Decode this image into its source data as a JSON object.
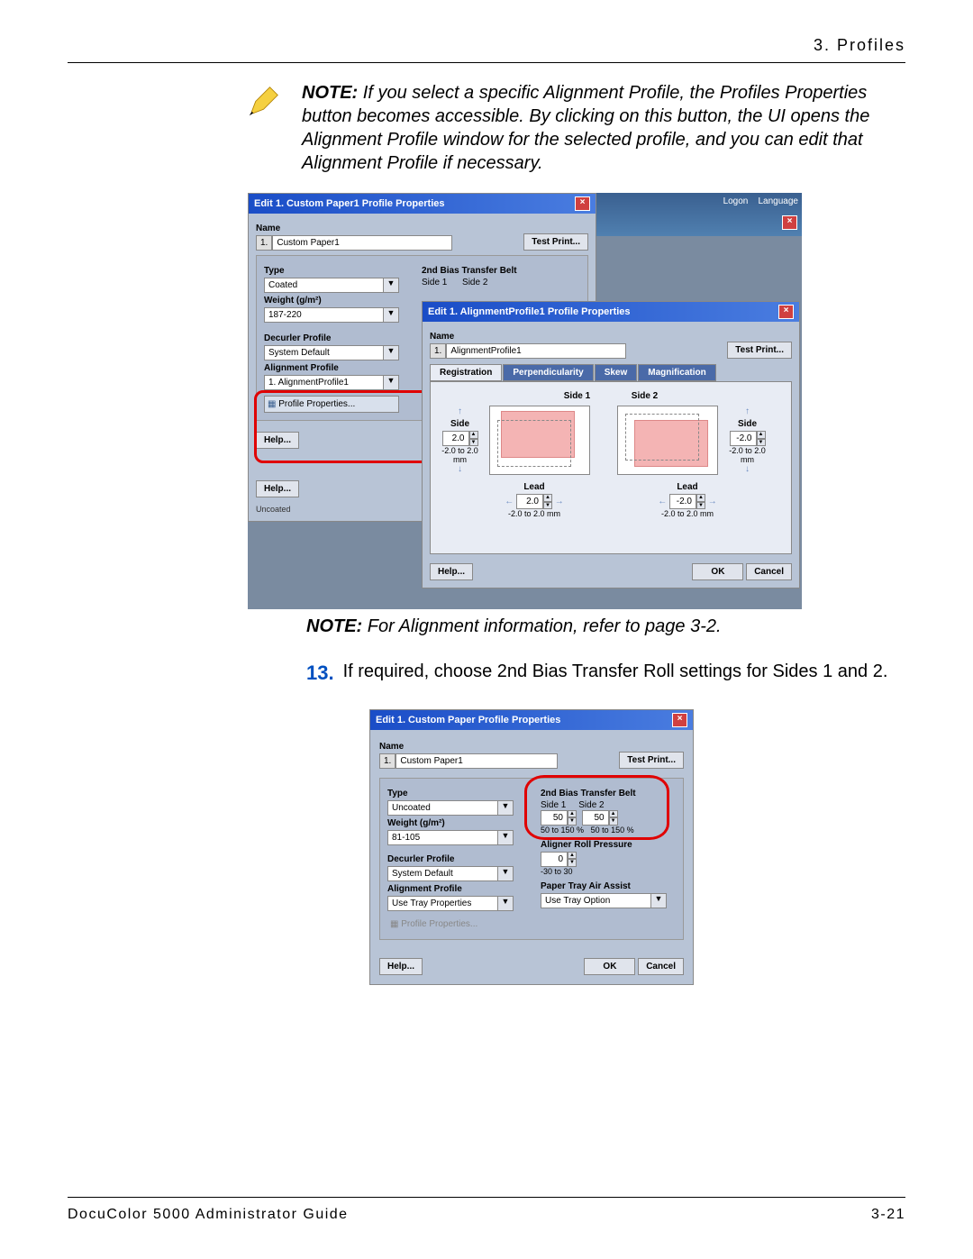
{
  "header": {
    "chapter": "3. Profiles"
  },
  "note1": {
    "prefix": "NOTE:",
    "body": " If you select a specific Alignment Profile, the Profiles Properties button becomes accessible. By clicking on this button, the UI opens the Alignment Profile window for the selected profile, and you can edit that Alignment Profile if necessary."
  },
  "win1": {
    "title": "Edit 1. Custom Paper1 Profile Properties",
    "name_label": "Name",
    "name_num": "1.",
    "name_value": "Custom Paper1",
    "test_print": "Test Print...",
    "type_label": "Type",
    "type_value": "Coated",
    "bias_label": "2nd Bias Transfer Belt",
    "side1": "Side 1",
    "side2": "Side 2",
    "weight_label": "Weight (g/m²)",
    "weight_value": "187-220",
    "decurler_label": "Decurler Profile",
    "decurler_value": "System Default",
    "alignment_label": "Alignment Profile",
    "alignment_value": "1. AlignmentProfile1",
    "profile_props": "Profile Properties...",
    "help": "Help...",
    "uncoated": "Uncoated"
  },
  "topbar": {
    "logon": "Logon",
    "lang": "Language"
  },
  "win2": {
    "title": "Edit 1. AlignmentProfile1 Profile Properties",
    "name_label": "Name",
    "name_num": "1.",
    "name_value": "AlignmentProfile1",
    "test_print": "Test Print...",
    "tabs": {
      "reg": "Registration",
      "perp": "Perpendicularity",
      "skew": "Skew",
      "mag": "Magnification"
    },
    "side1": "Side 1",
    "side2": "Side 2",
    "side": "Side",
    "lead": "Lead",
    "side_val1": "2.0",
    "side_val2": "-2.0",
    "lead_val1": "2.0",
    "lead_val2": "-2.0",
    "range": "-2.0 to 2.0 mm",
    "help": "Help...",
    "ok": "OK",
    "cancel": "Cancel"
  },
  "note2": {
    "prefix": "NOTE:",
    "body": " For Alignment information, refer to page 3-2."
  },
  "step13": {
    "num": "13.",
    "body": "If required, choose 2nd Bias Transfer Roll settings for Sides 1 and 2."
  },
  "s2": {
    "title": "Edit 1. Custom Paper Profile Properties",
    "name_label": "Name",
    "name_num": "1.",
    "name_value": "Custom Paper1",
    "test_print": "Test Print...",
    "type_label": "Type",
    "type_value": "Uncoated",
    "bias_label": "2nd Bias Transfer Belt",
    "side1": "Side 1",
    "side2": "Side 2",
    "bias_val": "50",
    "bias_range": "50 to 150 %",
    "weight_label": "Weight (g/m²)",
    "weight_value": "81-105",
    "aligner_label": "Aligner Roll Pressure",
    "aligner_val": "0",
    "aligner_range": "-30 to 30",
    "decurler_label": "Decurler Profile",
    "decurler_value": "System Default",
    "air_label": "Paper Tray Air Assist",
    "air_value": "Use Tray Option",
    "alignment_label": "Alignment Profile",
    "alignment_value": "Use Tray Properties",
    "profile_props": "Profile Properties...",
    "help": "Help...",
    "ok": "OK",
    "cancel": "Cancel"
  },
  "footer": {
    "left": "DocuColor 5000 Administrator Guide",
    "right": "3-21"
  }
}
